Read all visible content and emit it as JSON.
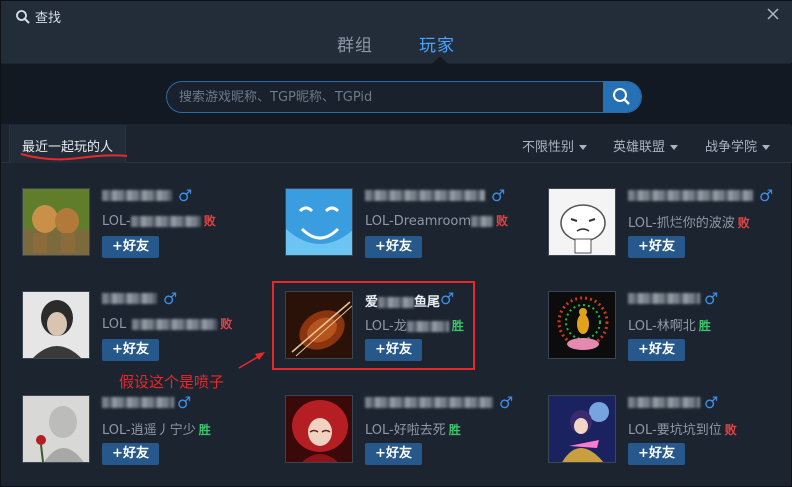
{
  "window": {
    "title": "查找"
  },
  "tabs": [
    {
      "label": "群组",
      "active": false
    },
    {
      "label": "玩家",
      "active": true
    }
  ],
  "search": {
    "placeholder": "搜索游戏昵称、TGP昵称、TGPid",
    "value": ""
  },
  "filters": {
    "tab_label": "最近一起玩的人",
    "gender": "不限性别",
    "game": "英雄联盟",
    "server": "战争学院"
  },
  "add_friend_label": "+好友",
  "players": [
    {
      "name_visible": "",
      "game_prefix": "LOL-",
      "sub_visible": "",
      "result": "败",
      "result_type": "lose",
      "gender": "♂"
    },
    {
      "name_visible": "",
      "game_prefix": "LOL-",
      "sub_visible": "Dreamroom",
      "result": "败",
      "result_type": "lose",
      "gender": "♂"
    },
    {
      "name_visible": "",
      "game_prefix": "LOL-",
      "sub_visible": "抓烂你的波波",
      "result": "败",
      "result_type": "lose",
      "gender": "♂"
    },
    {
      "name_visible": "",
      "game_prefix": "LOL",
      "sub_visible": "",
      "result": "败",
      "result_type": "lose",
      "gender": "♂"
    },
    {
      "name_visible": "爱",
      "name_suffix": "鱼尾",
      "game_prefix": "LOL-",
      "sub_visible": "龙",
      "result": "胜",
      "result_type": "win",
      "gender": "♂"
    },
    {
      "name_visible": "",
      "game_prefix": "LOL-",
      "sub_visible": "林啊北",
      "result": "胜",
      "result_type": "win",
      "gender": "♂"
    },
    {
      "name_visible": "",
      "game_prefix": "LOL-",
      "sub_visible": "逍遥丿宁少",
      "result": "胜",
      "result_type": "win",
      "gender": "♂"
    },
    {
      "name_visible": "",
      "game_prefix": "LOL-",
      "sub_visible": "好啦去死",
      "result": "胜",
      "result_type": "win",
      "gender": "♂"
    },
    {
      "name_visible": "",
      "game_prefix": "LOL-",
      "sub_visible": "要坑坑到位",
      "result": "败",
      "result_type": "lose",
      "gender": "♂"
    }
  ],
  "annotation": {
    "text": "假设这个是喷子"
  },
  "colors": {
    "accent": "#4aa3ff",
    "win": "#3bc66b",
    "lose": "#e04444",
    "annotation": "#e8282b",
    "button": "#26588c"
  }
}
